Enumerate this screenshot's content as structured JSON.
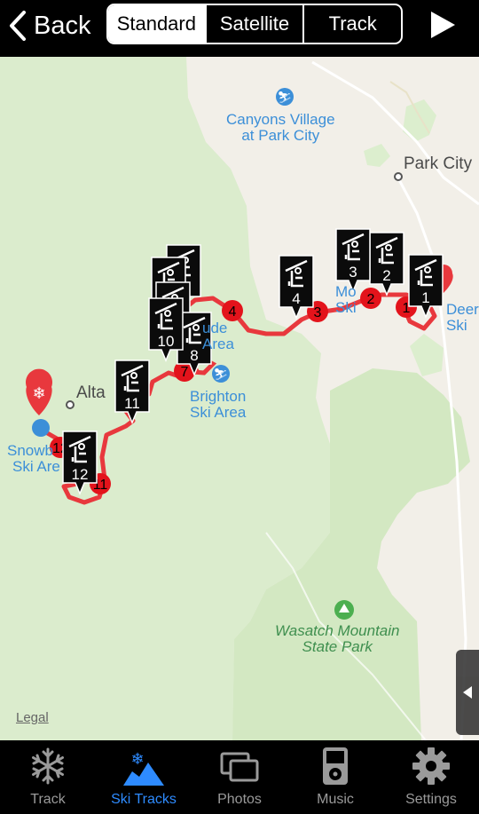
{
  "topbar": {
    "back_label": "Back"
  },
  "view_toggle": {
    "options": [
      "Standard",
      "Satellite",
      "Track"
    ],
    "selected": "Standard"
  },
  "map": {
    "labels": {
      "canyons": [
        "Canyons Village",
        "at Park City"
      ],
      "park_city": "Park City",
      "deer": [
        "Deer",
        "Ski"
      ],
      "brighton": [
        "Brighton",
        "Ski Area"
      ],
      "solitude": [
        "ude",
        "Area"
      ],
      "alta": "Alta",
      "snowbird": [
        "Snowb",
        "Ski Are"
      ],
      "wasatch": [
        "Wasatch Mountain",
        "State Park"
      ],
      "mountain": [
        "Mo",
        "Ski"
      ]
    },
    "legal_link": "Legal",
    "route_color": "#e8383d",
    "stop_markers": [
      "1",
      "2",
      "3",
      "4",
      "7",
      "11",
      "12"
    ],
    "lift_markers": [
      "1",
      "2",
      "3",
      "4",
      "8",
      "10",
      "11",
      "12"
    ]
  },
  "tabs": [
    {
      "label": "Track",
      "icon": "snowflake-icon"
    },
    {
      "label": "Ski Tracks",
      "icon": "ski-tracks-icon"
    },
    {
      "label": "Photos",
      "icon": "photos-icon"
    },
    {
      "label": "Music",
      "icon": "ipod-icon"
    },
    {
      "label": "Settings",
      "icon": "gear-icon"
    }
  ],
  "active_tab": "Ski Tracks",
  "colors": {
    "accent": "#2e8bff",
    "map_park": "#dceece",
    "route": "#e8383d"
  }
}
